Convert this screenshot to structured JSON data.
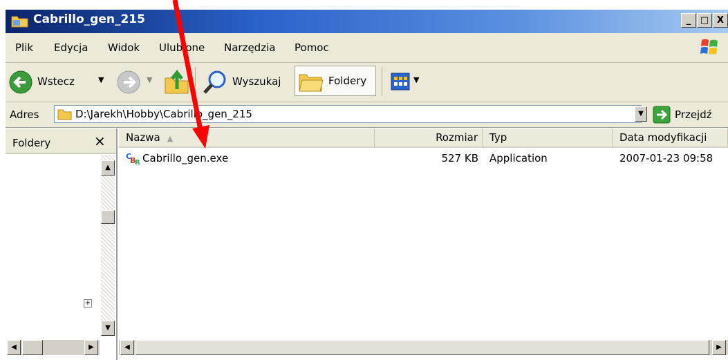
{
  "window": {
    "title": "Cabrillo_gen_215"
  },
  "menu": [
    "Plik",
    "Edycja",
    "Widok",
    "Ulubione",
    "Narzędzia",
    "Pomoc"
  ],
  "toolbar": {
    "back_label": "Wstecz",
    "search_label": "Wyszukaj",
    "folders_label": "Foldery"
  },
  "address": {
    "label": "Adres",
    "path": "D:\\Jarekh\\Hobby\\Cabrillo_gen_215",
    "go_label": "Przejdź"
  },
  "folders_pane": {
    "title": "Foldery",
    "close": "×"
  },
  "columns": {
    "name": "Nazwa",
    "size": "Rozmiar",
    "type": "Typ",
    "modified": "Data modyfikacji"
  },
  "files": [
    {
      "name": "Cabrillo_gen.exe",
      "size": "527 KB",
      "type": "Application",
      "modified": "2007-01-23 09:58"
    }
  ],
  "colors": {
    "title_start": "#0a246a",
    "title_end": "#a6caf0",
    "annotation_arrow": "#ff0000",
    "go_green": "#3aa53a"
  },
  "icons": [
    "folder-icon",
    "back-arrow-icon",
    "forward-arrow-icon",
    "up-folder-icon",
    "search-icon",
    "folders-icon",
    "views-icon",
    "go-arrow-icon",
    "windows-logo-icon",
    "exe-icon",
    "expand-plus-icon"
  ]
}
